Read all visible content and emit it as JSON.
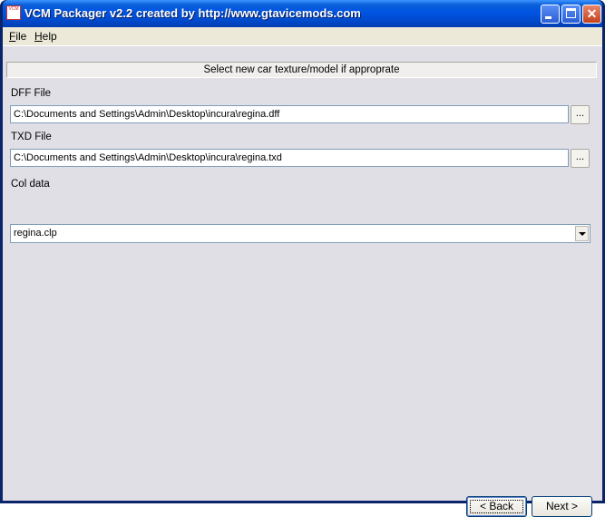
{
  "window": {
    "title": "VCM Packager v2.2 created by http://www.gtavicemods.com",
    "icon_text": "VCM",
    "controls": {
      "minimize": "minimize-icon",
      "maximize": "maximize-icon",
      "close": "close-icon"
    }
  },
  "menu": {
    "file": {
      "underline": "F",
      "rest": "ile"
    },
    "help": {
      "underline": "H",
      "rest": "elp"
    }
  },
  "content": {
    "header": "Select new car texture/model if approprate",
    "dff": {
      "label": "DFF File",
      "value": "C:\\Documents and Settings\\Admin\\Desktop\\incura\\regina.dff",
      "browse": "..."
    },
    "txd": {
      "label": "TXD File",
      "value": "C:\\Documents and Settings\\Admin\\Desktop\\incura\\regina.txd",
      "browse": "..."
    },
    "col": {
      "label": "Col data",
      "selected": "regina.clp"
    }
  },
  "buttons": {
    "back": "< Back",
    "next": "Next >"
  }
}
